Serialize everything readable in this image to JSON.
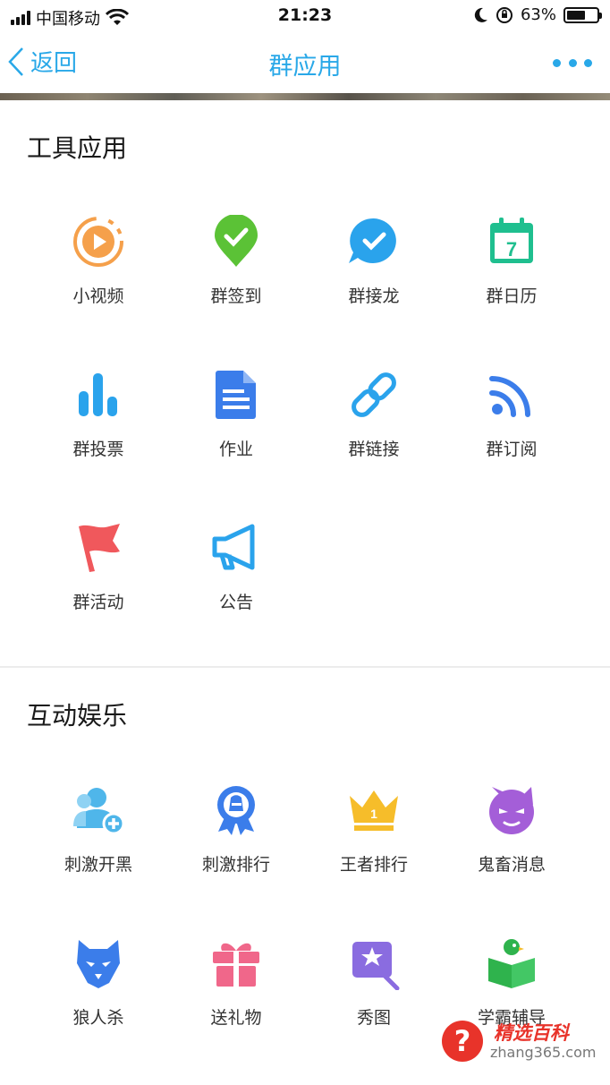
{
  "status_bar": {
    "carrier": "中国移动",
    "time": "21:23",
    "battery_percent": "63%",
    "battery_level": 0.63,
    "icons": [
      "signal-icon",
      "wifi-icon",
      "moon-icon",
      "orientation-lock-icon",
      "battery-icon"
    ]
  },
  "nav": {
    "back_label": "返回",
    "title": "群应用",
    "more_icon": "more-dots-icon"
  },
  "sections": [
    {
      "title": "工具应用",
      "apps": [
        {
          "label": "小视频",
          "icon": "video-play-icon",
          "color": "#f5a04b"
        },
        {
          "label": "群签到",
          "icon": "location-check-icon",
          "color": "#5bc236"
        },
        {
          "label": "群接龙",
          "icon": "chat-check-icon",
          "color": "#2aa3ec"
        },
        {
          "label": "群日历",
          "icon": "calendar-icon",
          "color": "#1fbf8f"
        },
        {
          "label": "群投票",
          "icon": "bar-chart-icon",
          "color": "#2aa3ec"
        },
        {
          "label": "作业",
          "icon": "document-icon",
          "color": "#3b7dea"
        },
        {
          "label": "群链接",
          "icon": "link-icon",
          "color": "#2aa3ec"
        },
        {
          "label": "群订阅",
          "icon": "rss-icon",
          "color": "#3b7dea"
        },
        {
          "label": "群活动",
          "icon": "flag-icon",
          "color": "#f0585c"
        },
        {
          "label": "公告",
          "icon": "megaphone-icon",
          "color": "#2aa3ec"
        }
      ]
    },
    {
      "title": "互动娱乐",
      "apps": [
        {
          "label": "刺激开黑",
          "icon": "add-friend-icon",
          "color": "#4fb6ea"
        },
        {
          "label": "刺激排行",
          "icon": "medal-icon",
          "color": "#3b7dea"
        },
        {
          "label": "王者排行",
          "icon": "crown-icon",
          "color": "#f6bd2a"
        },
        {
          "label": "鬼畜消息",
          "icon": "devil-icon",
          "color": "#a45ed8"
        },
        {
          "label": "狼人杀",
          "icon": "wolf-icon",
          "color": "#3b7dea"
        },
        {
          "label": "送礼物",
          "icon": "gift-icon",
          "color": "#f0678a"
        },
        {
          "label": "秀图",
          "icon": "magic-picture-icon",
          "color": "#8a6ce0"
        },
        {
          "label": "学霸辅导",
          "icon": "book-bird-icon",
          "color": "#2fb34d"
        }
      ]
    }
  ],
  "watermark": {
    "icon_text": "?",
    "brand": "精选百科",
    "url": "zhang365.com"
  }
}
